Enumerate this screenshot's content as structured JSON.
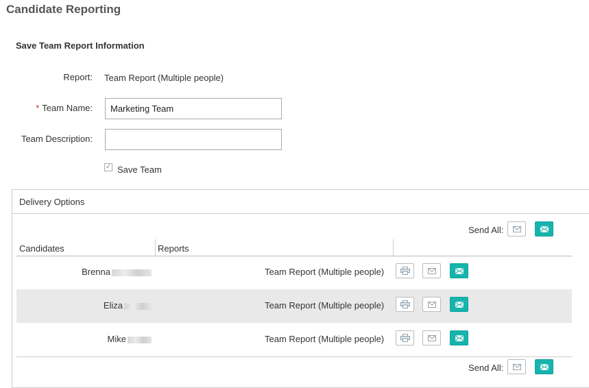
{
  "header": {
    "title": "Candidate Reporting"
  },
  "form": {
    "section_title": "Save Team Report Information",
    "report_label": "Report:",
    "report_value": "Team Report (Multiple people)",
    "team_name_required": "*",
    "team_name_label": "Team Name:",
    "team_name_value": "Marketing Team",
    "team_description_label": "Team Description:",
    "team_description_value": "",
    "save_team_label": "Save Team",
    "save_team_checked": true
  },
  "delivery": {
    "title": "Delivery Options",
    "send_all_label": "Send All:",
    "columns": [
      "Candidates",
      "Reports"
    ],
    "rows": [
      {
        "candidate": "Brenna",
        "report": "Team Report (Multiple people)"
      },
      {
        "candidate": "Eliza",
        "report": "Team Report (Multiple people)"
      },
      {
        "candidate": "Mike",
        "report": "Team Report (Multiple people)"
      }
    ]
  },
  "colors": {
    "accent": "#16b4ad",
    "stripe": "#e9e9e9",
    "required": "#c0392b"
  },
  "icons": [
    "printer-icon",
    "envelope-outline-icon",
    "envelope-filled-icon"
  ]
}
